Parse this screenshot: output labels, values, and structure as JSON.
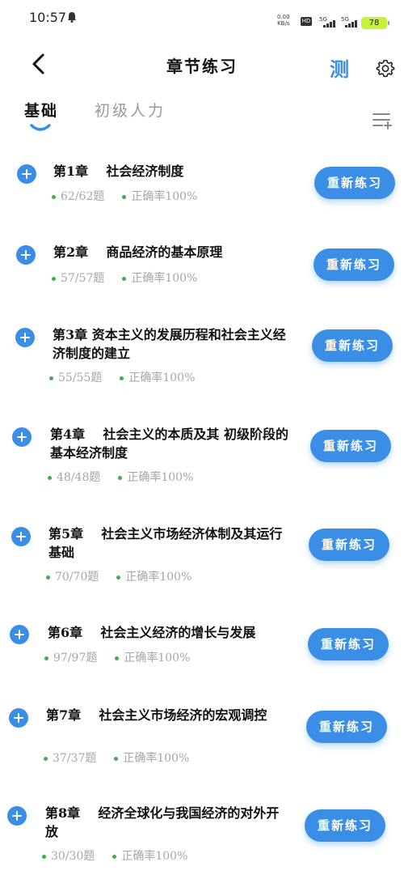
{
  "status_bar": {
    "time": "10:57",
    "net_speed_value": "0.00",
    "net_speed_unit": "KB/s",
    "hd_label": "HD",
    "sim1_label": "5G",
    "sim2_label": "5G",
    "battery": "78"
  },
  "nav": {
    "title": "章节练习",
    "test_label": "测"
  },
  "tabs": {
    "basic": "基础",
    "junior": "初级人力"
  },
  "chapters": [
    {
      "title": "第1章    社会经济制度",
      "progress": "62/62题",
      "accuracy": "正确率100%",
      "button": "重新练习"
    },
    {
      "title": "第2章    商品经济的基本原理",
      "progress": "57/57题",
      "accuracy": "正确率100%",
      "button": "重新练习"
    },
    {
      "title": "第3章 资本主义的发展历程和社会主义经济制度的建立",
      "progress": "55/55题",
      "accuracy": "正确率100%",
      "button": "重新练习"
    },
    {
      "title": "第4章    社会主义的本质及其 初级阶段的基本经济制度",
      "progress": "48/48题",
      "accuracy": "正确率100%",
      "button": "重新练习"
    },
    {
      "title": "第5章    社会主义市场经济体制及其运行基础",
      "progress": "70/70题",
      "accuracy": "正确率100%",
      "button": "重新练习"
    },
    {
      "title": "第6章    社会主义经济的增长与发展",
      "progress": "97/97题",
      "accuracy": "正确率100%",
      "button": "重新练习"
    },
    {
      "title": "第7章    社会主义市场经济的宏观调控",
      "progress": "37/37题",
      "accuracy": "正确率100%",
      "button": "重新练习"
    },
    {
      "title": "第8章    经济全球化与我国经济的对外开放",
      "progress": "30/30题",
      "accuracy": "正确率100%",
      "button": "重新练习"
    }
  ]
}
